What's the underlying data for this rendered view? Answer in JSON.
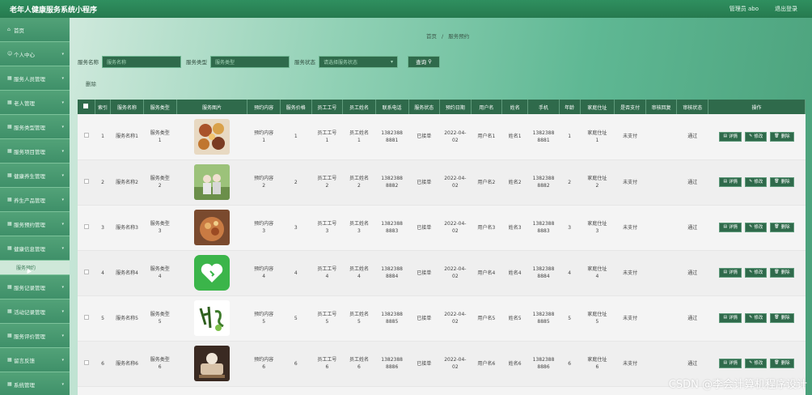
{
  "app": {
    "title": "老年人健康服务系统小程序",
    "user": "管理员 abo",
    "logout": "退出登录"
  },
  "sidebar": {
    "items": [
      {
        "label": "首页",
        "icon": "home-icon"
      },
      {
        "label": "个人中心",
        "icon": "person-icon"
      },
      {
        "label": "服务人员管理",
        "icon": "grid-icon"
      },
      {
        "label": "老人管理",
        "icon": "grid-icon"
      },
      {
        "label": "服务类型管理",
        "icon": "grid-icon"
      },
      {
        "label": "服务项目管理",
        "icon": "grid-icon"
      },
      {
        "label": "健康养生管理",
        "icon": "grid-icon"
      },
      {
        "label": "养生产品管理",
        "icon": "grid-icon"
      },
      {
        "label": "服务预约管理",
        "icon": "grid-icon"
      },
      {
        "label": "健康信息管理",
        "icon": "grid-icon"
      },
      {
        "label": "服务记录管理",
        "icon": "grid-icon"
      },
      {
        "label": "活动记录管理",
        "icon": "grid-icon"
      },
      {
        "label": "服务评价管理",
        "icon": "grid-icon"
      },
      {
        "label": "留言反馈",
        "icon": "grid-icon"
      },
      {
        "label": "系统管理",
        "icon": "grid-icon"
      }
    ],
    "active_sub": "服务预约"
  },
  "breadcrumb": {
    "home": "首页",
    "sep": "/",
    "current": "服务预约"
  },
  "filters": {
    "name_label": "服务名称",
    "name_placeholder": "服务名称",
    "type_label": "服务类型",
    "type_placeholder": "服务类型",
    "status_label": "服务状态",
    "status_placeholder": "请选择服务状态",
    "search_button": "查询"
  },
  "delete_link": "删除",
  "table": {
    "headers": [
      "索引",
      "服务名称",
      "服务类型",
      "服务图片",
      "预约内容",
      "服务价格",
      "员工工号",
      "员工姓名",
      "联系电话",
      "服务状态",
      "预约日期",
      "用户名",
      "姓名",
      "手机",
      "年龄",
      "家庭住址",
      "是否支付",
      "审核回复",
      "审核状态",
      "操作"
    ],
    "rows": [
      {
        "idx": "1",
        "name": "服务名称1",
        "type": "服务类型\n1",
        "content": "预约内容\n1",
        "price": "1",
        "empno": "员工工号\n1",
        "empname": "员工姓名\n1",
        "phone": "1382388\n8881",
        "status": "已接单",
        "date": "2022-04-\n02",
        "user": "用户名1",
        "realname": "姓名1",
        "mobile": "1382388\n8881",
        "age": "1",
        "addr": "家庭住址\n1",
        "paid": "未支付",
        "reply": "",
        "audit": "通过"
      },
      {
        "idx": "2",
        "name": "服务名称2",
        "type": "服务类型\n2",
        "content": "预约内容\n2",
        "price": "2",
        "empno": "员工工号\n2",
        "empname": "员工姓名\n2",
        "phone": "1382388\n8882",
        "status": "已接单",
        "date": "2022-04-\n02",
        "user": "用户名2",
        "realname": "姓名2",
        "mobile": "1382388\n8882",
        "age": "2",
        "addr": "家庭住址\n2",
        "paid": "未支付",
        "reply": "",
        "audit": "通过"
      },
      {
        "idx": "3",
        "name": "服务名称3",
        "type": "服务类型\n3",
        "content": "预约内容\n3",
        "price": "3",
        "empno": "员工工号\n3",
        "empname": "员工姓名\n3",
        "phone": "1382388\n8883",
        "status": "已接单",
        "date": "2022-04-\n02",
        "user": "用户名3",
        "realname": "姓名3",
        "mobile": "1382388\n8883",
        "age": "3",
        "addr": "家庭住址\n3",
        "paid": "未支付",
        "reply": "",
        "audit": "通过"
      },
      {
        "idx": "4",
        "name": "服务名称4",
        "type": "服务类型\n4",
        "content": "预约内容\n4",
        "price": "4",
        "empno": "员工工号\n4",
        "empname": "员工姓名\n4",
        "phone": "1382388\n8884",
        "status": "已接单",
        "date": "2022-04-\n02",
        "user": "用户名4",
        "realname": "姓名4",
        "mobile": "1382388\n8884",
        "age": "4",
        "addr": "家庭住址\n4",
        "paid": "未支付",
        "reply": "",
        "audit": "通过"
      },
      {
        "idx": "5",
        "name": "服务名称5",
        "type": "服务类型\n5",
        "content": "预约内容\n5",
        "price": "5",
        "empno": "员工工号\n5",
        "empname": "员工姓名\n5",
        "phone": "1382388\n8885",
        "status": "已接单",
        "date": "2022-04-\n02",
        "user": "用户名5",
        "realname": "姓名5",
        "mobile": "1382388\n8885",
        "age": "5",
        "addr": "家庭住址\n5",
        "paid": "未支付",
        "reply": "",
        "audit": "通过"
      },
      {
        "idx": "6",
        "name": "服务名称6",
        "type": "服务类型\n6",
        "content": "预约内容\n6",
        "price": "6",
        "empno": "员工工号\n6",
        "empname": "员工姓名\n6",
        "phone": "1382388\n8886",
        "status": "已接单",
        "date": "2022-04-\n02",
        "user": "用户名6",
        "realname": "姓名6",
        "mobile": "1382388\n8886",
        "age": "6",
        "addr": "家庭住址\n6",
        "paid": "未支付",
        "reply": "",
        "audit": "通过"
      }
    ],
    "actions": {
      "detail": "详情",
      "edit": "修改",
      "delete": "删除"
    }
  },
  "thumb_colors": [
    "#c98a4e",
    "#8fb26a",
    "#b86b3f",
    "#3bb54a",
    "#ffffff",
    "#6b4a3a"
  ],
  "thumb_icons": [
    "food-bowls-image",
    "elderly-couple-image",
    "food-plate-image",
    "heart-logo-image",
    "health-calligraphy-image",
    "cooking-image"
  ],
  "watermark": "CSDN @李会计算机程序设计"
}
